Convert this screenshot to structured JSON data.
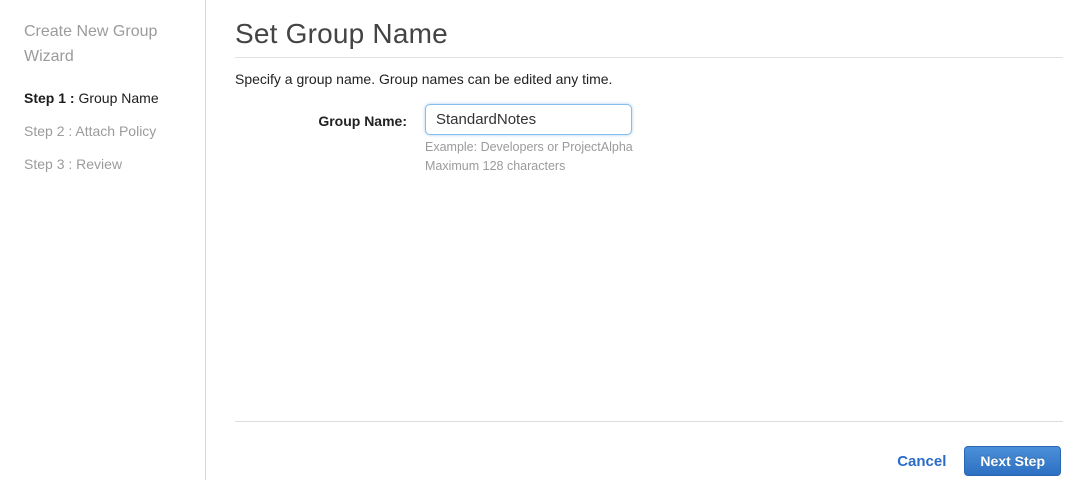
{
  "sidebar": {
    "title": "Create New Group Wizard",
    "steps": [
      {
        "prefix": "Step 1 : ",
        "label": "Group Name",
        "active": true
      },
      {
        "prefix": "Step 2 : ",
        "label": "Attach Policy",
        "active": false
      },
      {
        "prefix": "Step 3 : ",
        "label": "Review",
        "active": false
      }
    ]
  },
  "main": {
    "title": "Set Group Name",
    "description": "Specify a group name. Group names can be edited any time.",
    "form": {
      "label": "Group Name:",
      "value": "StandardNotes",
      "hint_example": "Example: Developers or ProjectAlpha",
      "hint_max": "Maximum 128 characters"
    },
    "footer": {
      "cancel_label": "Cancel",
      "next_label": "Next Step"
    }
  },
  "colors": {
    "accent_blue": "#2b6cc8",
    "button_gradient_top": "#4b90d9",
    "button_gradient_bottom": "#2d6fc2",
    "input_focus_border": "#85bdec",
    "inactive_gray": "#9b9b9b"
  }
}
